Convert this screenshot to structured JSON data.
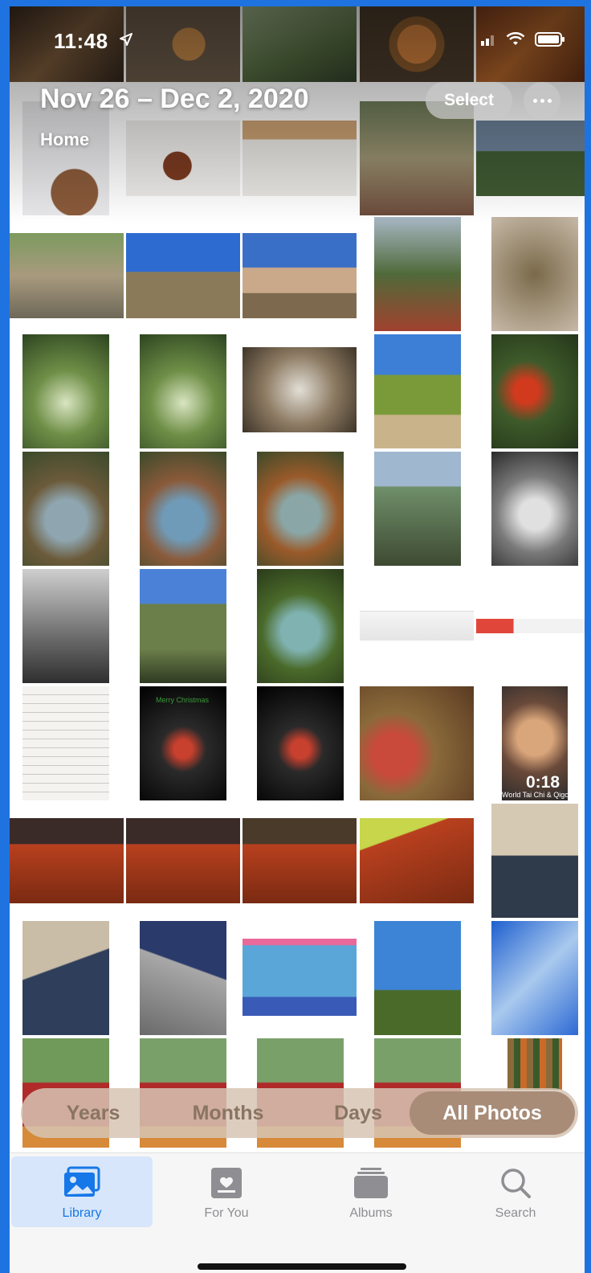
{
  "status_bar": {
    "time": "11:48"
  },
  "header": {
    "date_range": "Nov 26 – Dec 2, 2020",
    "location": "Home",
    "select_label": "Select"
  },
  "grid": {
    "video_duration": "0:18",
    "video_caption": "World Tai Chi & Qigong Day",
    "card_text": "Merry Christmas"
  },
  "segmented_control": {
    "years": "Years",
    "months": "Months",
    "days": "Days",
    "all_photos": "All Photos",
    "selected": "All Photos"
  },
  "tab_bar": {
    "library": "Library",
    "for_you": "For You",
    "albums": "Albums",
    "search": "Search",
    "active": "Library"
  },
  "colors": {
    "accent": "#1577e8",
    "segment_bg": "#d6c4b4",
    "segment_active": "#a88c78",
    "frame": "#1f73e0"
  },
  "icons": {
    "location": "location-arrow-icon",
    "signal": "cellular-signal-icon",
    "wifi": "wifi-icon",
    "battery": "battery-icon",
    "more": "ellipsis-icon",
    "library": "photo-library-icon",
    "for_you": "for-you-icon",
    "albums": "albums-icon",
    "search": "search-icon"
  }
}
